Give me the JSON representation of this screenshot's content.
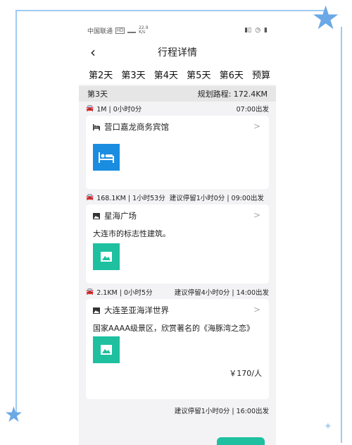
{
  "status": {
    "carrier": "中国联通",
    "hd": "HD",
    "speed_top": "22.9",
    "speed_bottom": "K/s"
  },
  "nav": {
    "title": "行程详情",
    "back_icon": "chevron-left-icon"
  },
  "tabs": [
    "第2天",
    "第3天",
    "第4天",
    "第5天",
    "第6天",
    "预算"
  ],
  "day": {
    "label": "第3天",
    "route": "规划路程: 172.4KM"
  },
  "legs": [
    {
      "left": "1M | 0小时0分",
      "middle": "",
      "right": "07:00出发"
    },
    {
      "left": "168.1KM | 1小时53分",
      "middle": "",
      "right": "建议停留1小时0分 | 09:00出发"
    },
    {
      "left": "2.1KM | 0小时5分",
      "middle": "",
      "right": "建议停留4小时0分 | 14:00出发"
    },
    {
      "left": "",
      "middle": "",
      "right": "建议停留1小时0分 | 16:00出发"
    }
  ],
  "cards": [
    {
      "title": "营口嘉龙商务宾馆",
      "icon": "bed-icon",
      "desc": "",
      "price": ""
    },
    {
      "title": "星海广场",
      "icon": "image-icon",
      "desc": "大连市的标志性建筑。",
      "price": ""
    },
    {
      "title": "大连圣亚海洋世界",
      "icon": "image-icon",
      "desc": "国家AAAA级景区，欣赏著名的《海豚湾之恋》",
      "price": "￥170/人"
    }
  ],
  "colors": {
    "accent_blue": "#1a8de0",
    "accent_green": "#1ec0a0",
    "day_header_bg": "#e6e6e6"
  }
}
